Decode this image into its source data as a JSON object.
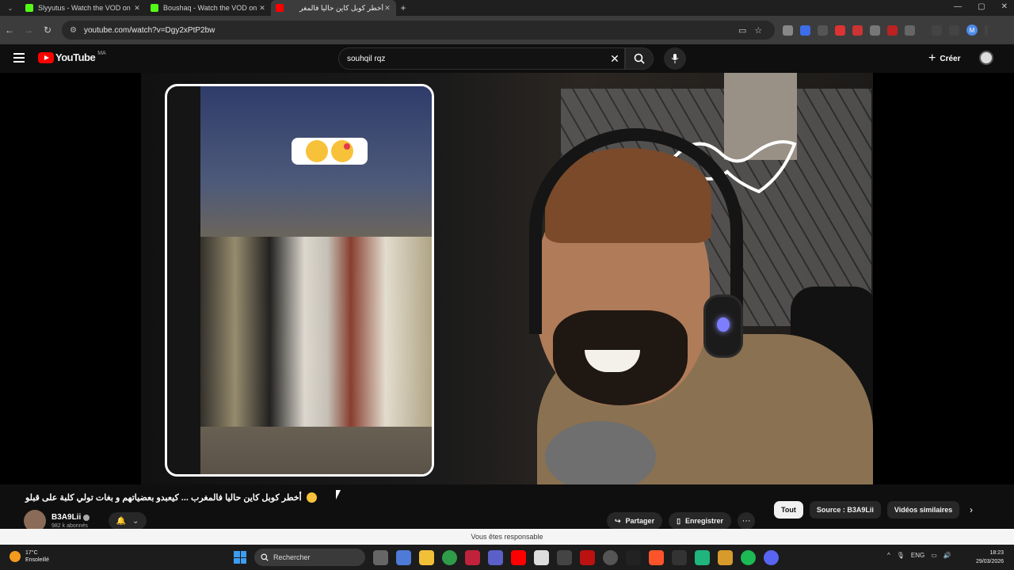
{
  "browser": {
    "tabs": [
      {
        "title": "Slyyutus - Watch the VOD on I",
        "color": "#53fc18",
        "active": false
      },
      {
        "title": "Boushaq - Watch the VOD on I",
        "color": "#53fc18",
        "active": false
      },
      {
        "title": "أخطر كوبل كاين حاليا فالمغر",
        "color": "#ff0000",
        "active": true
      }
    ],
    "url": "youtube.com/watch?v=Dgy2xPtP2bw"
  },
  "youtube": {
    "logo_text": "YouTube",
    "country_code": "MA",
    "search_value": "souhqil rqz",
    "create_label": "Créer"
  },
  "video": {
    "title": "أخطر كوبل كاين حاليا فالمغرب ... كيعبدو بعضياتهم و بغات تولي كلبة على قبلو",
    "channel_name": "B3A9Lii",
    "subscribers": "982 k abonnés",
    "share_label": "Partager",
    "save_label": "Enregistrer"
  },
  "chips": [
    "Tout",
    "Source : B3A9Lii",
    "Vidéos similaires"
  ],
  "toast": "Vous êtes responsable",
  "taskbar": {
    "temperature": "17°C",
    "condition": "Ensoleillé",
    "search_label": "Rechercher",
    "language": "ENG",
    "time": "18:23",
    "date": "29/03/2026"
  }
}
